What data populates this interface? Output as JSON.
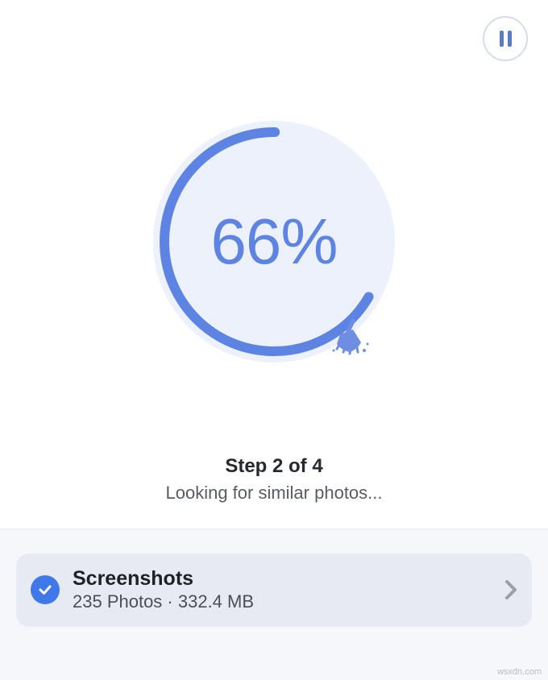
{
  "progress": {
    "percent_value": 66,
    "percent_label": "66%",
    "stroke_dash": "569 284",
    "arc_color": "#5e84e3",
    "bg_color": "#ecf1fb"
  },
  "status": {
    "step_label": "Step 2 of 4",
    "detail": "Looking for similar photos..."
  },
  "result": {
    "title": "Screenshots",
    "subtitle": "235 Photos · 332.4 MB",
    "checked": true
  },
  "icons": {
    "pause": "pause-icon",
    "broom": "broom-icon",
    "check": "check-icon",
    "chevron": "chevron-right-icon"
  },
  "watermark": "wsxdn.com"
}
